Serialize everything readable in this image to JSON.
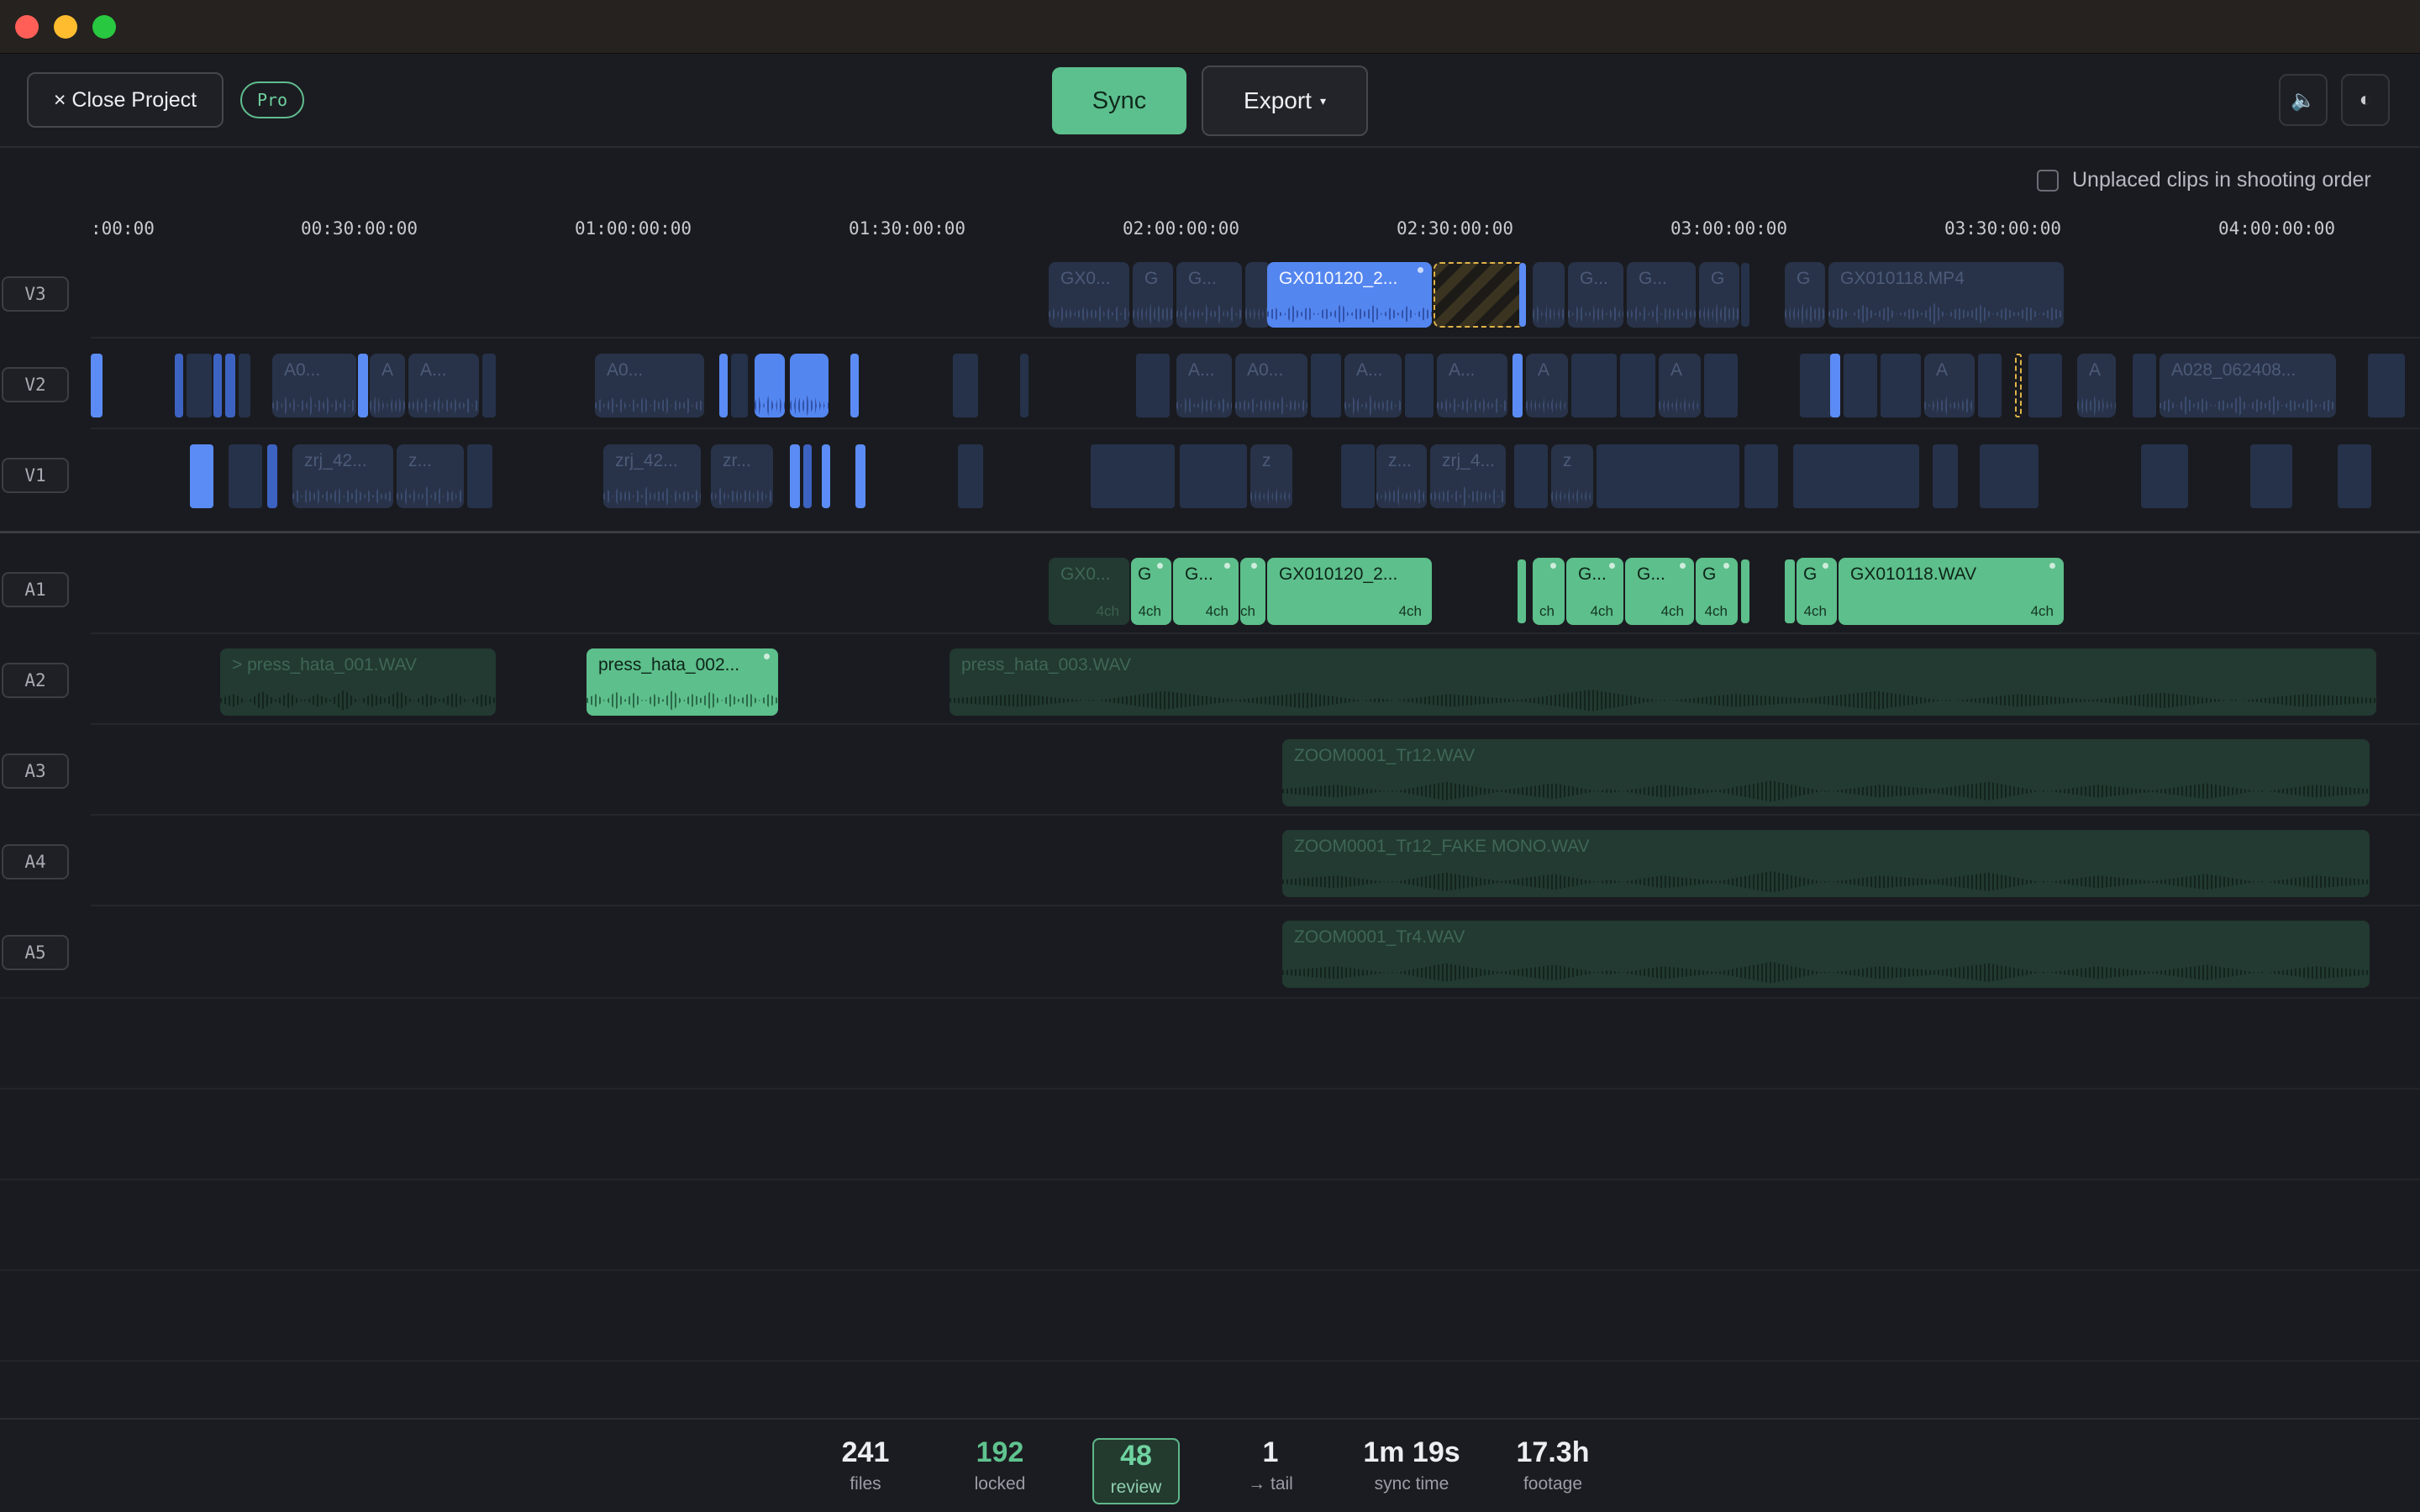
{
  "toolbar": {
    "close_label": "× Close Project",
    "plan_badge": "Pro",
    "sync_label": "Sync",
    "export_label": "Export",
    "export_caret": "▾",
    "audio_icon": "🔈",
    "theme_icon": "◐"
  },
  "options": {
    "unplaced_label": "Unplaced clips in shooting order",
    "unplaced_checked": false
  },
  "timeline": {
    "ticks": [
      ":00:00",
      "00:30:00:00",
      "01:00:00:00",
      "01:30:00:00",
      "02:00:00:00",
      "02:30:00:00",
      "03:00:00:00",
      "03:30:00:00",
      "04:00:00:00"
    ],
    "video_tracks": [
      "V3",
      "V2",
      "V1"
    ],
    "audio_tracks": [
      "A1",
      "A2",
      "A3",
      "A4",
      "A5"
    ],
    "v3_clips": {
      "c1": "GX0...",
      "c2": "G",
      "c3": "G...",
      "selected": "GX010120_2...",
      "c5": "G...",
      "c6": "G...",
      "c7": "G",
      "c8": "G",
      "c9": "GX010118.MP4"
    },
    "v2_clips": {
      "c1": "A0...",
      "c2": "A",
      "c3": "A...",
      "c4": "A0...",
      "c5": "A...",
      "c6": "A0...",
      "c7": "A...",
      "c8": "A...",
      "c9": "A",
      "c10": "A",
      "c11": "A",
      "c12": "A",
      "c13": "A028_062408..."
    },
    "v1_clips": {
      "c1": "zrj_42...",
      "c2": "z...",
      "c3": "zrj_42...",
      "c4": "zr...",
      "c5": "z",
      "c6": "z...",
      "c7": "zrj_4...",
      "c8": "z"
    },
    "a1_clips": {
      "c1": "GX0...",
      "c1_ch": "4ch",
      "c2": "G",
      "c2_ch": "4ch",
      "c3": "G...",
      "c3_ch": "4ch",
      "c4": "",
      "c4_ch": "ch",
      "c5": "GX010120_2...",
      "c5_ch": "4ch",
      "c6_ch": "ch",
      "c7": "G...",
      "c7_ch": "4ch",
      "c8": "G...",
      "c8_ch": "4ch",
      "c9": "G",
      "c9_ch": "4ch",
      "c10": "G",
      "c10_ch": "4ch",
      "c11": "GX010118.WAV",
      "c11_ch": "4ch"
    },
    "a2_clips": {
      "c1": "> press_hata_001.WAV",
      "c2": "press_hata_002...",
      "c3": "press_hata_003.WAV"
    },
    "a3_clips": {
      "c1": "ZOOM0001_Tr12.WAV"
    },
    "a4_clips": {
      "c1": "ZOOM0001_Tr12_FAKE MONO.WAV"
    },
    "a5_clips": {
      "c1": "ZOOM0001_Tr4.WAV"
    }
  },
  "stats": [
    {
      "value": "241",
      "label": "files"
    },
    {
      "value": "192",
      "label": "locked"
    },
    {
      "value": "48",
      "label": "review"
    },
    {
      "value": "1",
      "label": "→ tail"
    },
    {
      "value": "1m 19s",
      "label": "sync time"
    },
    {
      "value": "17.3h",
      "label": "footage"
    }
  ],
  "colors": {
    "accent_green": "#5dbf8b",
    "accent_blue": "#5486f0",
    "warning_amber": "#e0b34a",
    "background": "#1a1b20"
  }
}
